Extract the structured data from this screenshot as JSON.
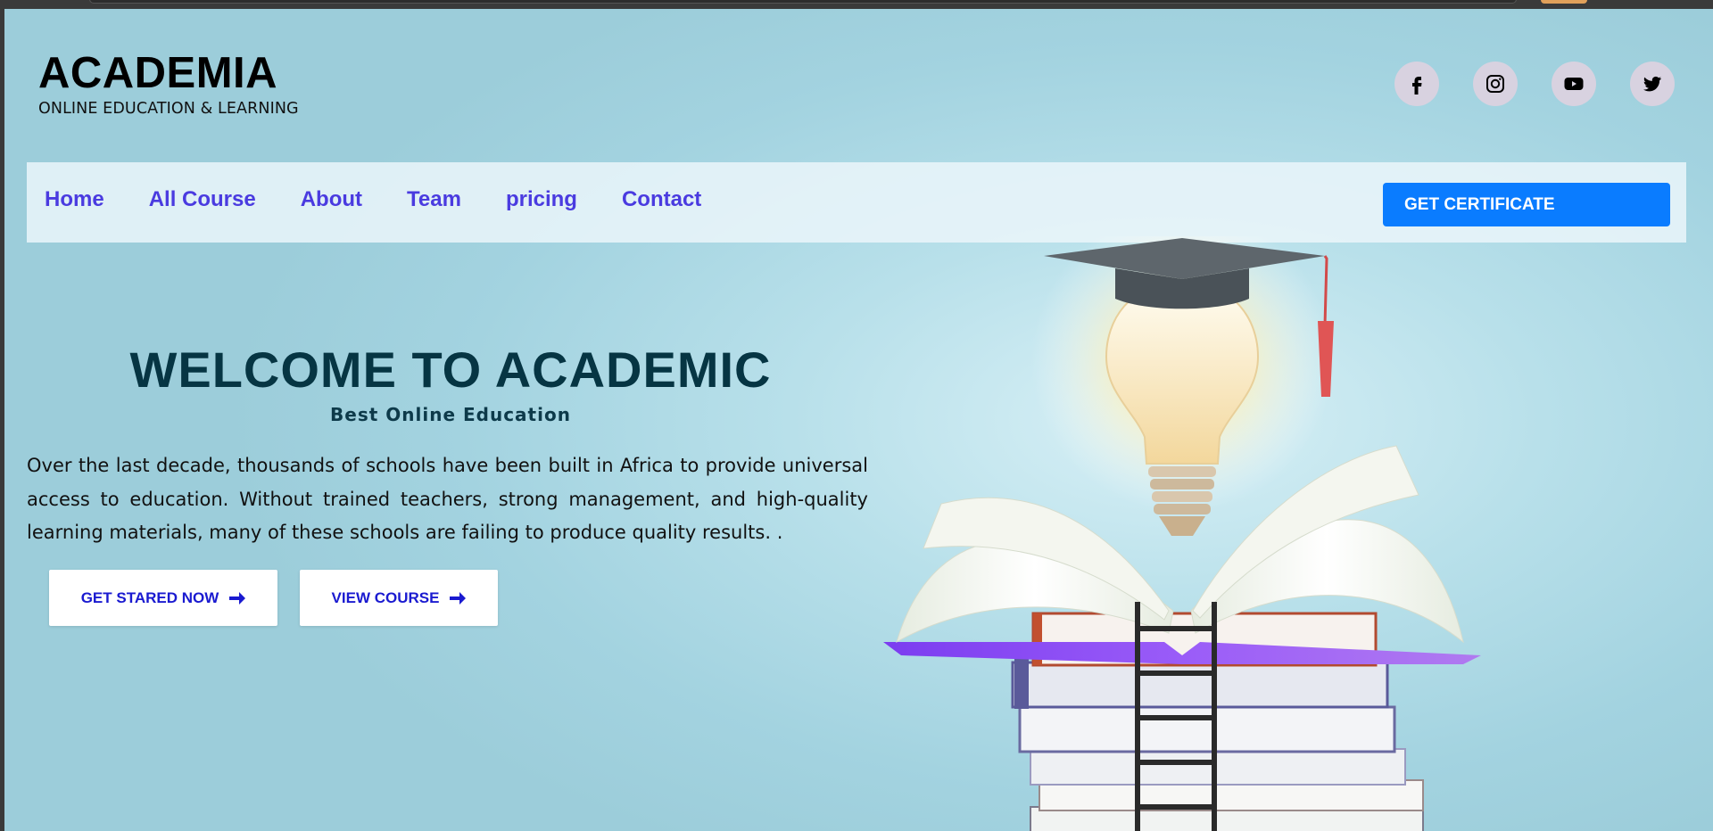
{
  "brand": {
    "title": "ACADEMIA",
    "subtitle": "ONLINE EDUCATION & LEARNING"
  },
  "socials": [
    {
      "icon": "facebook-icon"
    },
    {
      "icon": "instagram-icon"
    },
    {
      "icon": "youtube-icon"
    },
    {
      "icon": "twitter-icon"
    }
  ],
  "nav": {
    "links": [
      "Home",
      "All Course",
      "About",
      "Team",
      "pricing",
      "Contact"
    ],
    "cta_label": "GET CERTIFICATE"
  },
  "hero": {
    "title": "WELCOME TO ACADEMIC",
    "subtitle": "Best Online Education",
    "body": "Over the last decade, thousands of schools have been built in Africa to provide universal access to education. Without trained teachers, strong management, and high-quality learning materials, many of these schools are failing to produce quality results. .",
    "primary_button": "GET STARED NOW",
    "secondary_button": "VIEW COURSE",
    "button_icon": "arrow-right-icon"
  },
  "colors": {
    "nav_link": "#4a3be0",
    "cta_bg": "#0a7cff",
    "hero_title": "#063543",
    "button_text": "#1a1ad0"
  }
}
